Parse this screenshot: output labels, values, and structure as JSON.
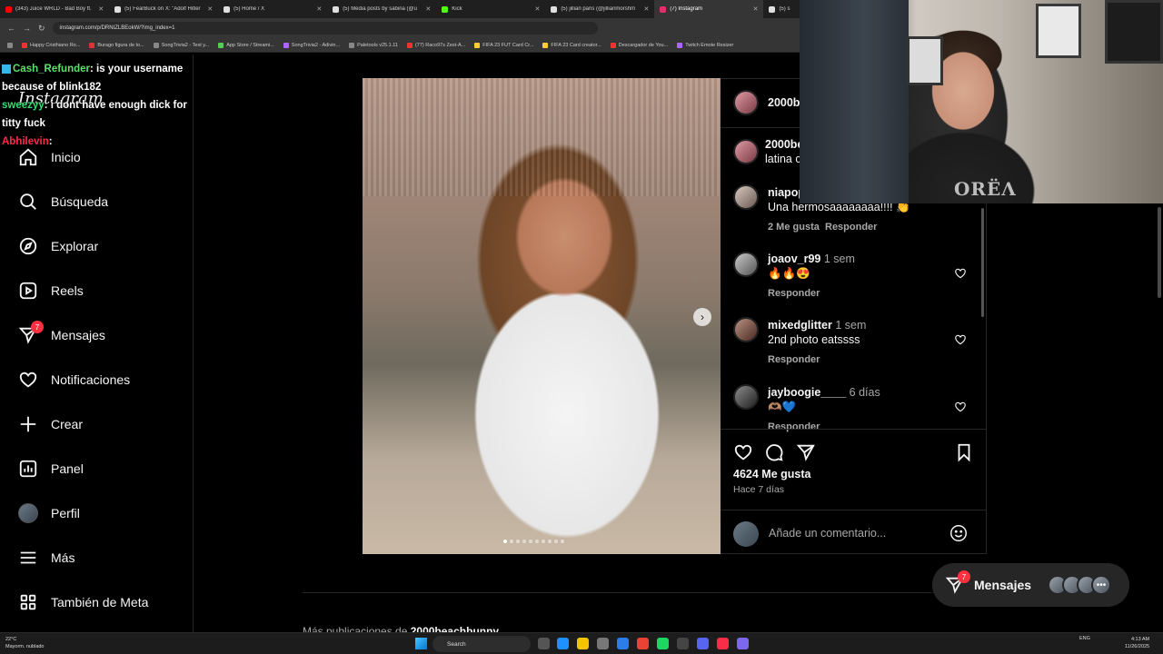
{
  "browser": {
    "tabs": [
      {
        "label": "(343) Juice WRLD - Bad Boy ft.",
        "color": "#ff0000"
      },
      {
        "label": "(5) FearBuck on X: \"Adolf Hitler",
        "color": "#e0e0e0"
      },
      {
        "label": "(5) Home / X",
        "color": "#e0e0e0"
      },
      {
        "label": "(5) Media posts by sabina (@u",
        "color": "#e0e0e0"
      },
      {
        "label": "Kick",
        "color": "#53fc18"
      },
      {
        "label": "(5) jillian paris (@jillianmorshm",
        "color": "#e0e0e0"
      },
      {
        "label": "(7) Instagram",
        "color": "#e1306c"
      },
      {
        "label": "(5) s",
        "color": "#e0e0e0"
      }
    ],
    "url": "instagram.com/p/DRNIZLBEokW/?img_index=1",
    "bookmarks": [
      "Happy Cristhiano Ro...",
      "Burago figura de to...",
      "SongTrivia2 - Test y...",
      "App Store / Streami...",
      "SongTrivia2 - Adivin...",
      "Paletools v25.1.11",
      "(77) Raco97s Zest-A...",
      "FIFA 23 FUT Card Cr...",
      "FIFA 23 Card creator...",
      "Descargador de You...",
      "Twitch Emote Resizer"
    ]
  },
  "chat": [
    {
      "user": "Cash_Refunder",
      "text": ": is your username because of blink182"
    },
    {
      "user": "sweezyy",
      "text": ": i dont have enough dick for titty fuck"
    },
    {
      "user": "Abhilevin",
      "text": ":"
    }
  ],
  "sidebar": {
    "logo": "Instagram",
    "items": [
      {
        "label": "Inicio",
        "icon": "home-icon"
      },
      {
        "label": "Búsqueda",
        "icon": "search-icon"
      },
      {
        "label": "Explorar",
        "icon": "compass-icon"
      },
      {
        "label": "Reels",
        "icon": "reels-icon"
      },
      {
        "label": "Mensajes",
        "icon": "messenger-icon",
        "badge": "7"
      },
      {
        "label": "Notificaciones",
        "icon": "heart-icon"
      },
      {
        "label": "Crear",
        "icon": "plus-icon"
      },
      {
        "label": "Panel",
        "icon": "dashboard-icon"
      },
      {
        "label": "Perfil",
        "icon": "avatar"
      },
      {
        "label": "Más",
        "icon": "menu-icon"
      },
      {
        "label": "También de Meta",
        "icon": "meta-icon"
      }
    ]
  },
  "post": {
    "author": "2000b",
    "caption_author": "2000be",
    "caption_text": "latina c",
    "comments": [
      {
        "user": "niapop",
        "text": "Una hermosaaaaaaaa!!!! 👏",
        "likes": "2 Me gusta",
        "reply": "Responder"
      },
      {
        "user": "joaov_r99",
        "time": "1 sem",
        "text": "🔥🔥😍",
        "reply": "Responder"
      },
      {
        "user": "mixedglitter",
        "time": "1 sem",
        "text": "2nd photo eatssss",
        "reply": "Responder"
      },
      {
        "user": "jayboogie____",
        "time": "6 días",
        "text": "🫶🏽💙",
        "reply": "Responder"
      }
    ],
    "likes": "4624 Me gusta",
    "ago": "Hace 7 días",
    "comment_placeholder": "Añade un comentario...",
    "carousel_dots": 10
  },
  "more_posts": {
    "prefix": "Más publicaciones de ",
    "user": "2000beachbunny"
  },
  "messages_pill": {
    "label": "Mensajes",
    "badge": "7"
  },
  "webcam": {
    "shirt_text": "ОRЁΛ"
  },
  "taskbar": {
    "weather_temp": "22°C",
    "weather_desc": "Mayorm. nublado",
    "search": "Search",
    "lang": "ENG",
    "time": "4:13 AM",
    "date": "11/26/2025"
  }
}
